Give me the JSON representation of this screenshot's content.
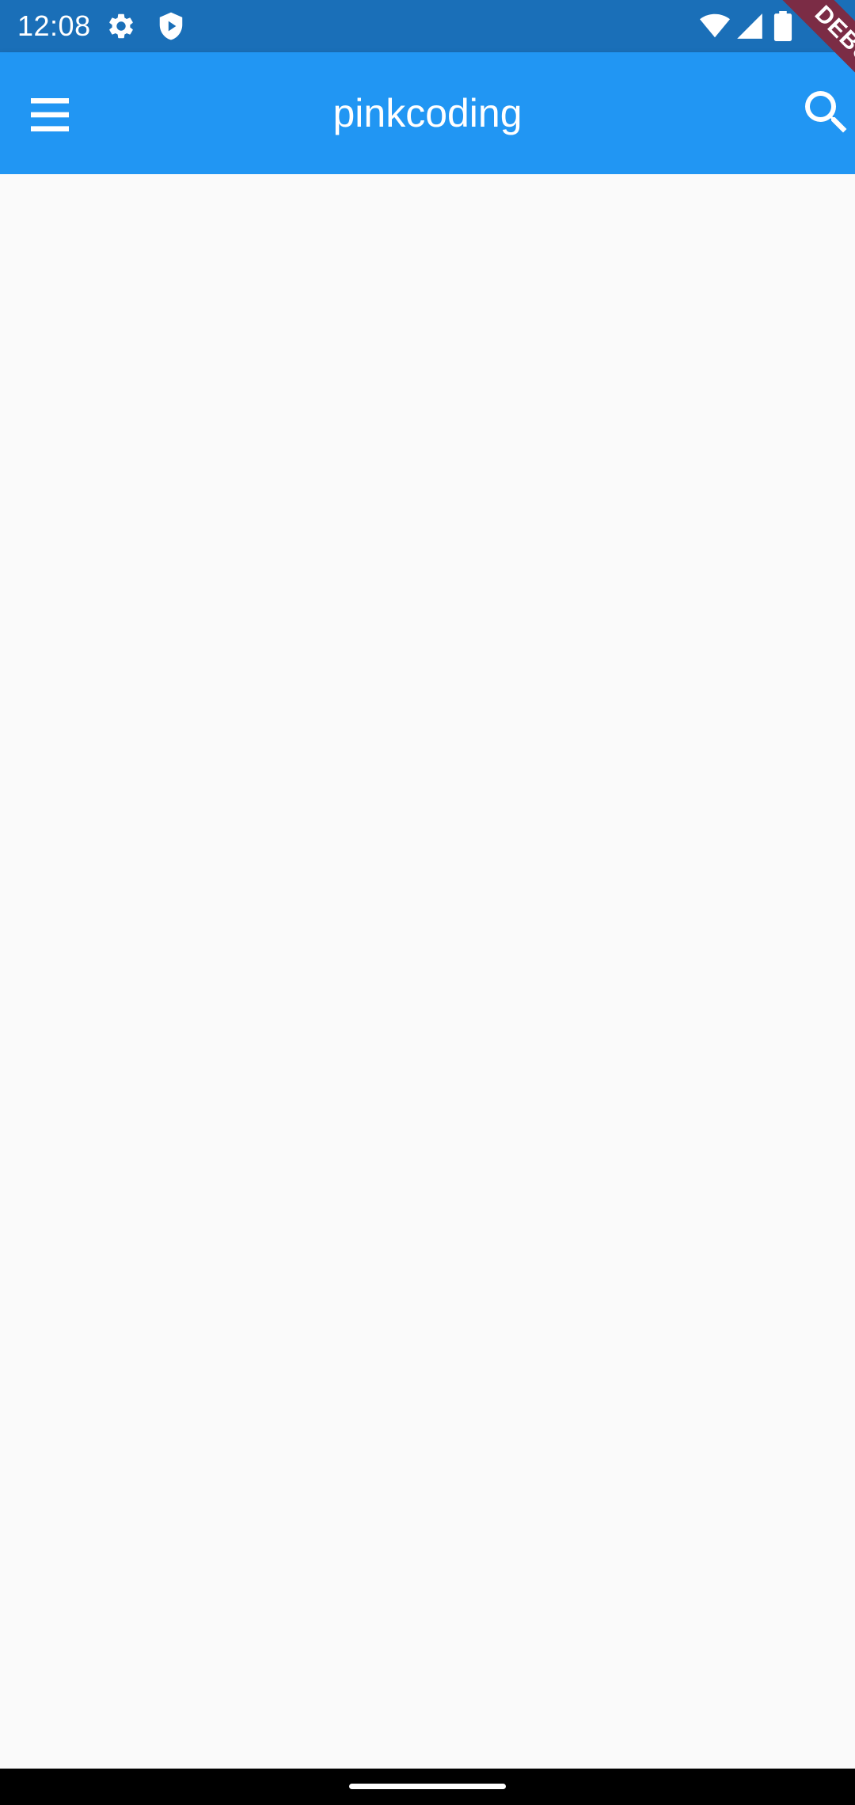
{
  "status_bar": {
    "time": "12:08",
    "icons": [
      "settings-icon",
      "shield-play-icon",
      "wifi-icon",
      "cell-signal-icon",
      "battery-icon"
    ]
  },
  "app_bar": {
    "title": "pinkcoding",
    "leading_icon": "menu-icon",
    "trailing_icon": "search-icon",
    "color": "#2196f3"
  },
  "debug_banner": {
    "label": "DEBUG",
    "color": "#7b2c45"
  },
  "colors": {
    "status_bar": "#1a6fb8",
    "background": "#fafafa",
    "nav_bar": "#000000"
  }
}
